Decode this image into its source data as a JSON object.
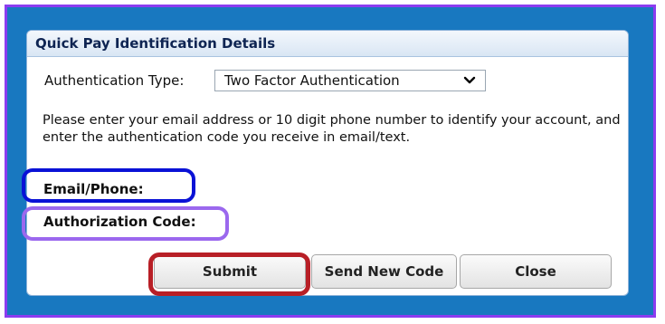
{
  "dialog": {
    "title": "Quick Pay Identification Details",
    "auth_type_label": "Authentication Type:",
    "auth_type_value": "Two Factor Authentication",
    "description": "Please enter your email address or 10 digit phone number to identify your account, and enter the authentication code you receive in email/text.",
    "email_phone_label": "Email/Phone:",
    "authorization_code_label": "Authorization Code:"
  },
  "buttons": {
    "submit": "Submit",
    "send_new_code": "Send New Code",
    "close": "Close"
  },
  "icons": {
    "dropdown": "chevron-down-icon"
  },
  "colors": {
    "frame_blue": "#1878c0",
    "outer_border_purple": "#8b3cf0",
    "email_highlight": "#0a12d6",
    "authorization_highlight": "#9b68ee",
    "submit_highlight": "#b81f26",
    "header_text": "#0e2452"
  }
}
